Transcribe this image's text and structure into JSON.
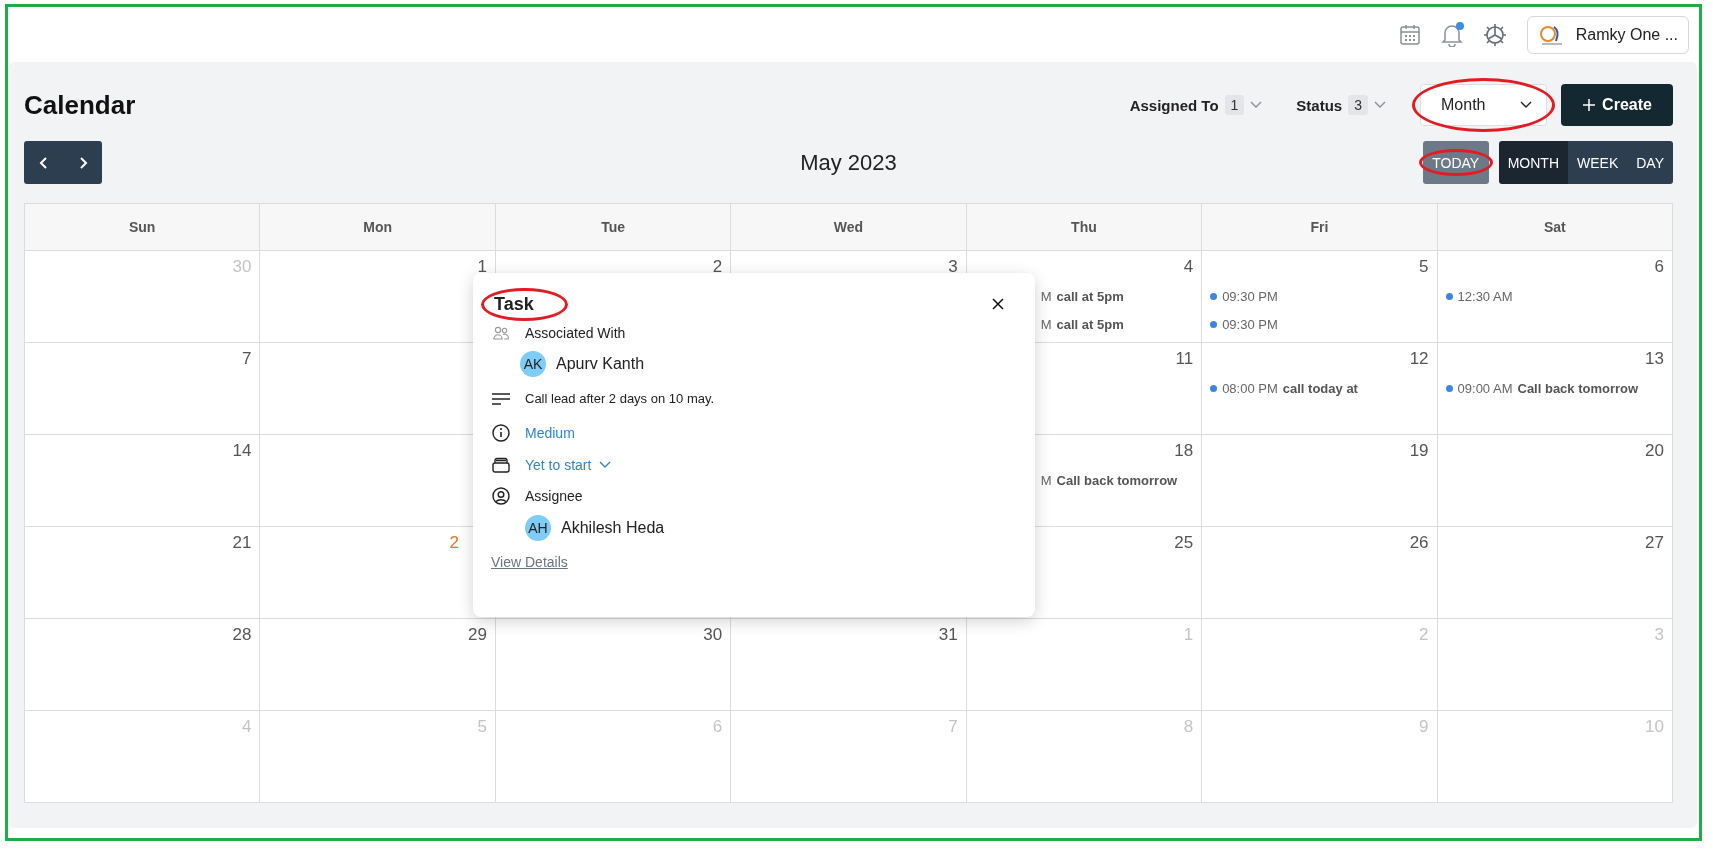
{
  "topbar": {
    "notifications_unread": true,
    "account": {
      "name": "Ramky One ..."
    }
  },
  "page_title": "Calendar",
  "filters": [
    {
      "label": "Assigned To",
      "count": "1"
    },
    {
      "label": "Status",
      "count": "3"
    }
  ],
  "view_select": {
    "value": "Month",
    "highlighted": true
  },
  "create_button": {
    "label": "Create"
  },
  "month_label": "May 2023",
  "today_button": {
    "label": "TODAY",
    "highlighted": true
  },
  "view_tabs": [
    {
      "label": "MONTH",
      "selected": true
    },
    {
      "label": "WEEK",
      "selected": false
    },
    {
      "label": "DAY",
      "selected": false
    }
  ],
  "weekdays": [
    "Sun",
    "Mon",
    "Tue",
    "Wed",
    "Thu",
    "Fri",
    "Sat"
  ],
  "weeks": [
    {
      "sun": {
        "day": "30",
        "muted": true
      },
      "mon": {
        "day": "1",
        "muted": false
      },
      "tue": {
        "day": "2",
        "muted": false
      },
      "wed": {
        "day": "3",
        "muted": false
      },
      "thu": {
        "day": "4",
        "muted": false,
        "events": [
          {
            "kind": "partial",
            "time": "M",
            "title": "call at 5pm"
          },
          {
            "kind": "partial",
            "time": "M",
            "title": "call at 5pm"
          }
        ]
      },
      "fri": {
        "day": "5",
        "muted": false,
        "events": [
          {
            "kind": "full",
            "time": "09:30 PM"
          },
          {
            "kind": "full",
            "time": "09:30 PM"
          }
        ]
      },
      "sat": {
        "day": "6",
        "muted": false,
        "events": [
          {
            "kind": "full",
            "time": "12:30 AM"
          }
        ]
      }
    },
    {
      "sun": {
        "day": "7",
        "muted": false
      },
      "thu": {
        "day": "11",
        "muted": false
      },
      "fri": {
        "day": "12",
        "muted": false,
        "events": [
          {
            "kind": "full",
            "time": "08:00 PM",
            "title": "call today at"
          }
        ]
      },
      "sat": {
        "day": "13",
        "muted": false,
        "events": [
          {
            "kind": "full",
            "time": "09:00 AM",
            "title": "Call back tomorrow"
          }
        ]
      }
    },
    {
      "sun": {
        "day": "14",
        "muted": false
      },
      "thu": {
        "day": "18",
        "muted": false,
        "events": [
          {
            "kind": "partial",
            "time": "M",
            "title": "Call back tomorrow"
          }
        ]
      },
      "fri": {
        "day": "19",
        "muted": false
      },
      "sat": {
        "day": "20",
        "muted": false
      }
    },
    {
      "sun": {
        "day": "21",
        "muted": false
      },
      "mon": {
        "day": "2",
        "muted": false,
        "today": true
      },
      "thu": {
        "day": "25",
        "muted": false
      },
      "fri": {
        "day": "26",
        "muted": false
      },
      "sat": {
        "day": "27",
        "muted": false
      }
    },
    {
      "sun": {
        "day": "28",
        "muted": false
      },
      "mon": {
        "day": "29",
        "muted": false
      },
      "tue": {
        "day": "30",
        "muted": false
      },
      "wed": {
        "day": "31",
        "muted": false
      },
      "thu": {
        "day": "1",
        "muted": true
      },
      "fri": {
        "day": "2",
        "muted": true
      },
      "sat": {
        "day": "3",
        "muted": true
      }
    },
    {
      "sun": {
        "day": "4",
        "muted": true
      },
      "mon": {
        "day": "5",
        "muted": true
      },
      "tue": {
        "day": "6",
        "muted": true
      },
      "wed": {
        "day": "7",
        "muted": true
      },
      "thu": {
        "day": "8",
        "muted": true
      },
      "fri": {
        "day": "9",
        "muted": true
      },
      "sat": {
        "day": "10",
        "muted": true
      }
    }
  ],
  "popup": {
    "title": "Task",
    "highlighted": true,
    "associated_label": "Associated With",
    "associated": {
      "initials": "AK",
      "name": "Apurv Kanth"
    },
    "description": "Call lead after 2 days on 10 may.",
    "priority": "Medium",
    "status": "Yet to start",
    "assignee_label": "Assignee",
    "assignee": {
      "initials": "AH",
      "name": "Akhilesh Heda"
    },
    "link": "View Details"
  }
}
